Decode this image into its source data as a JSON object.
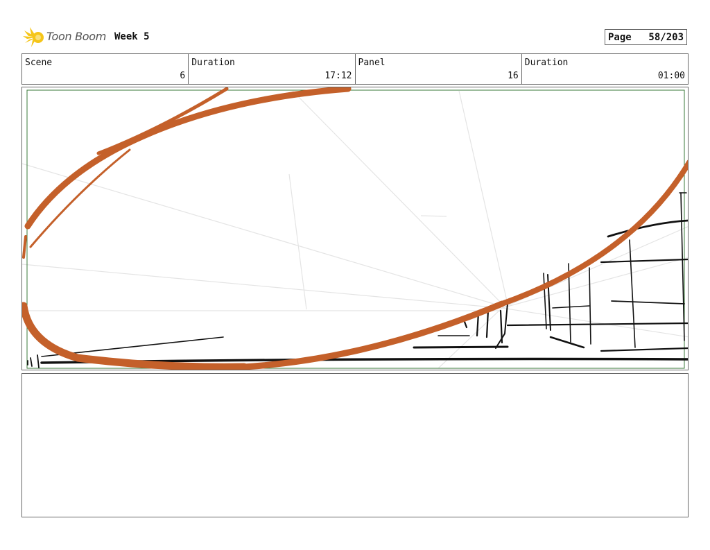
{
  "header": {
    "logo_text": "Toon Boom",
    "project_title": "Week 5",
    "page_label": "Page",
    "page_value": "58/203"
  },
  "info": [
    {
      "label": "Scene",
      "value": "6"
    },
    {
      "label": "Duration",
      "value": "17:12"
    },
    {
      "label": "Panel",
      "value": "16"
    },
    {
      "label": "Duration",
      "value": "01:00"
    }
  ],
  "colors": {
    "sketch_orange": "#c4602a",
    "frame_green": "#3a7a3a",
    "ink": "#111111"
  },
  "icons": {
    "logo": "sunburst-logo-icon"
  }
}
